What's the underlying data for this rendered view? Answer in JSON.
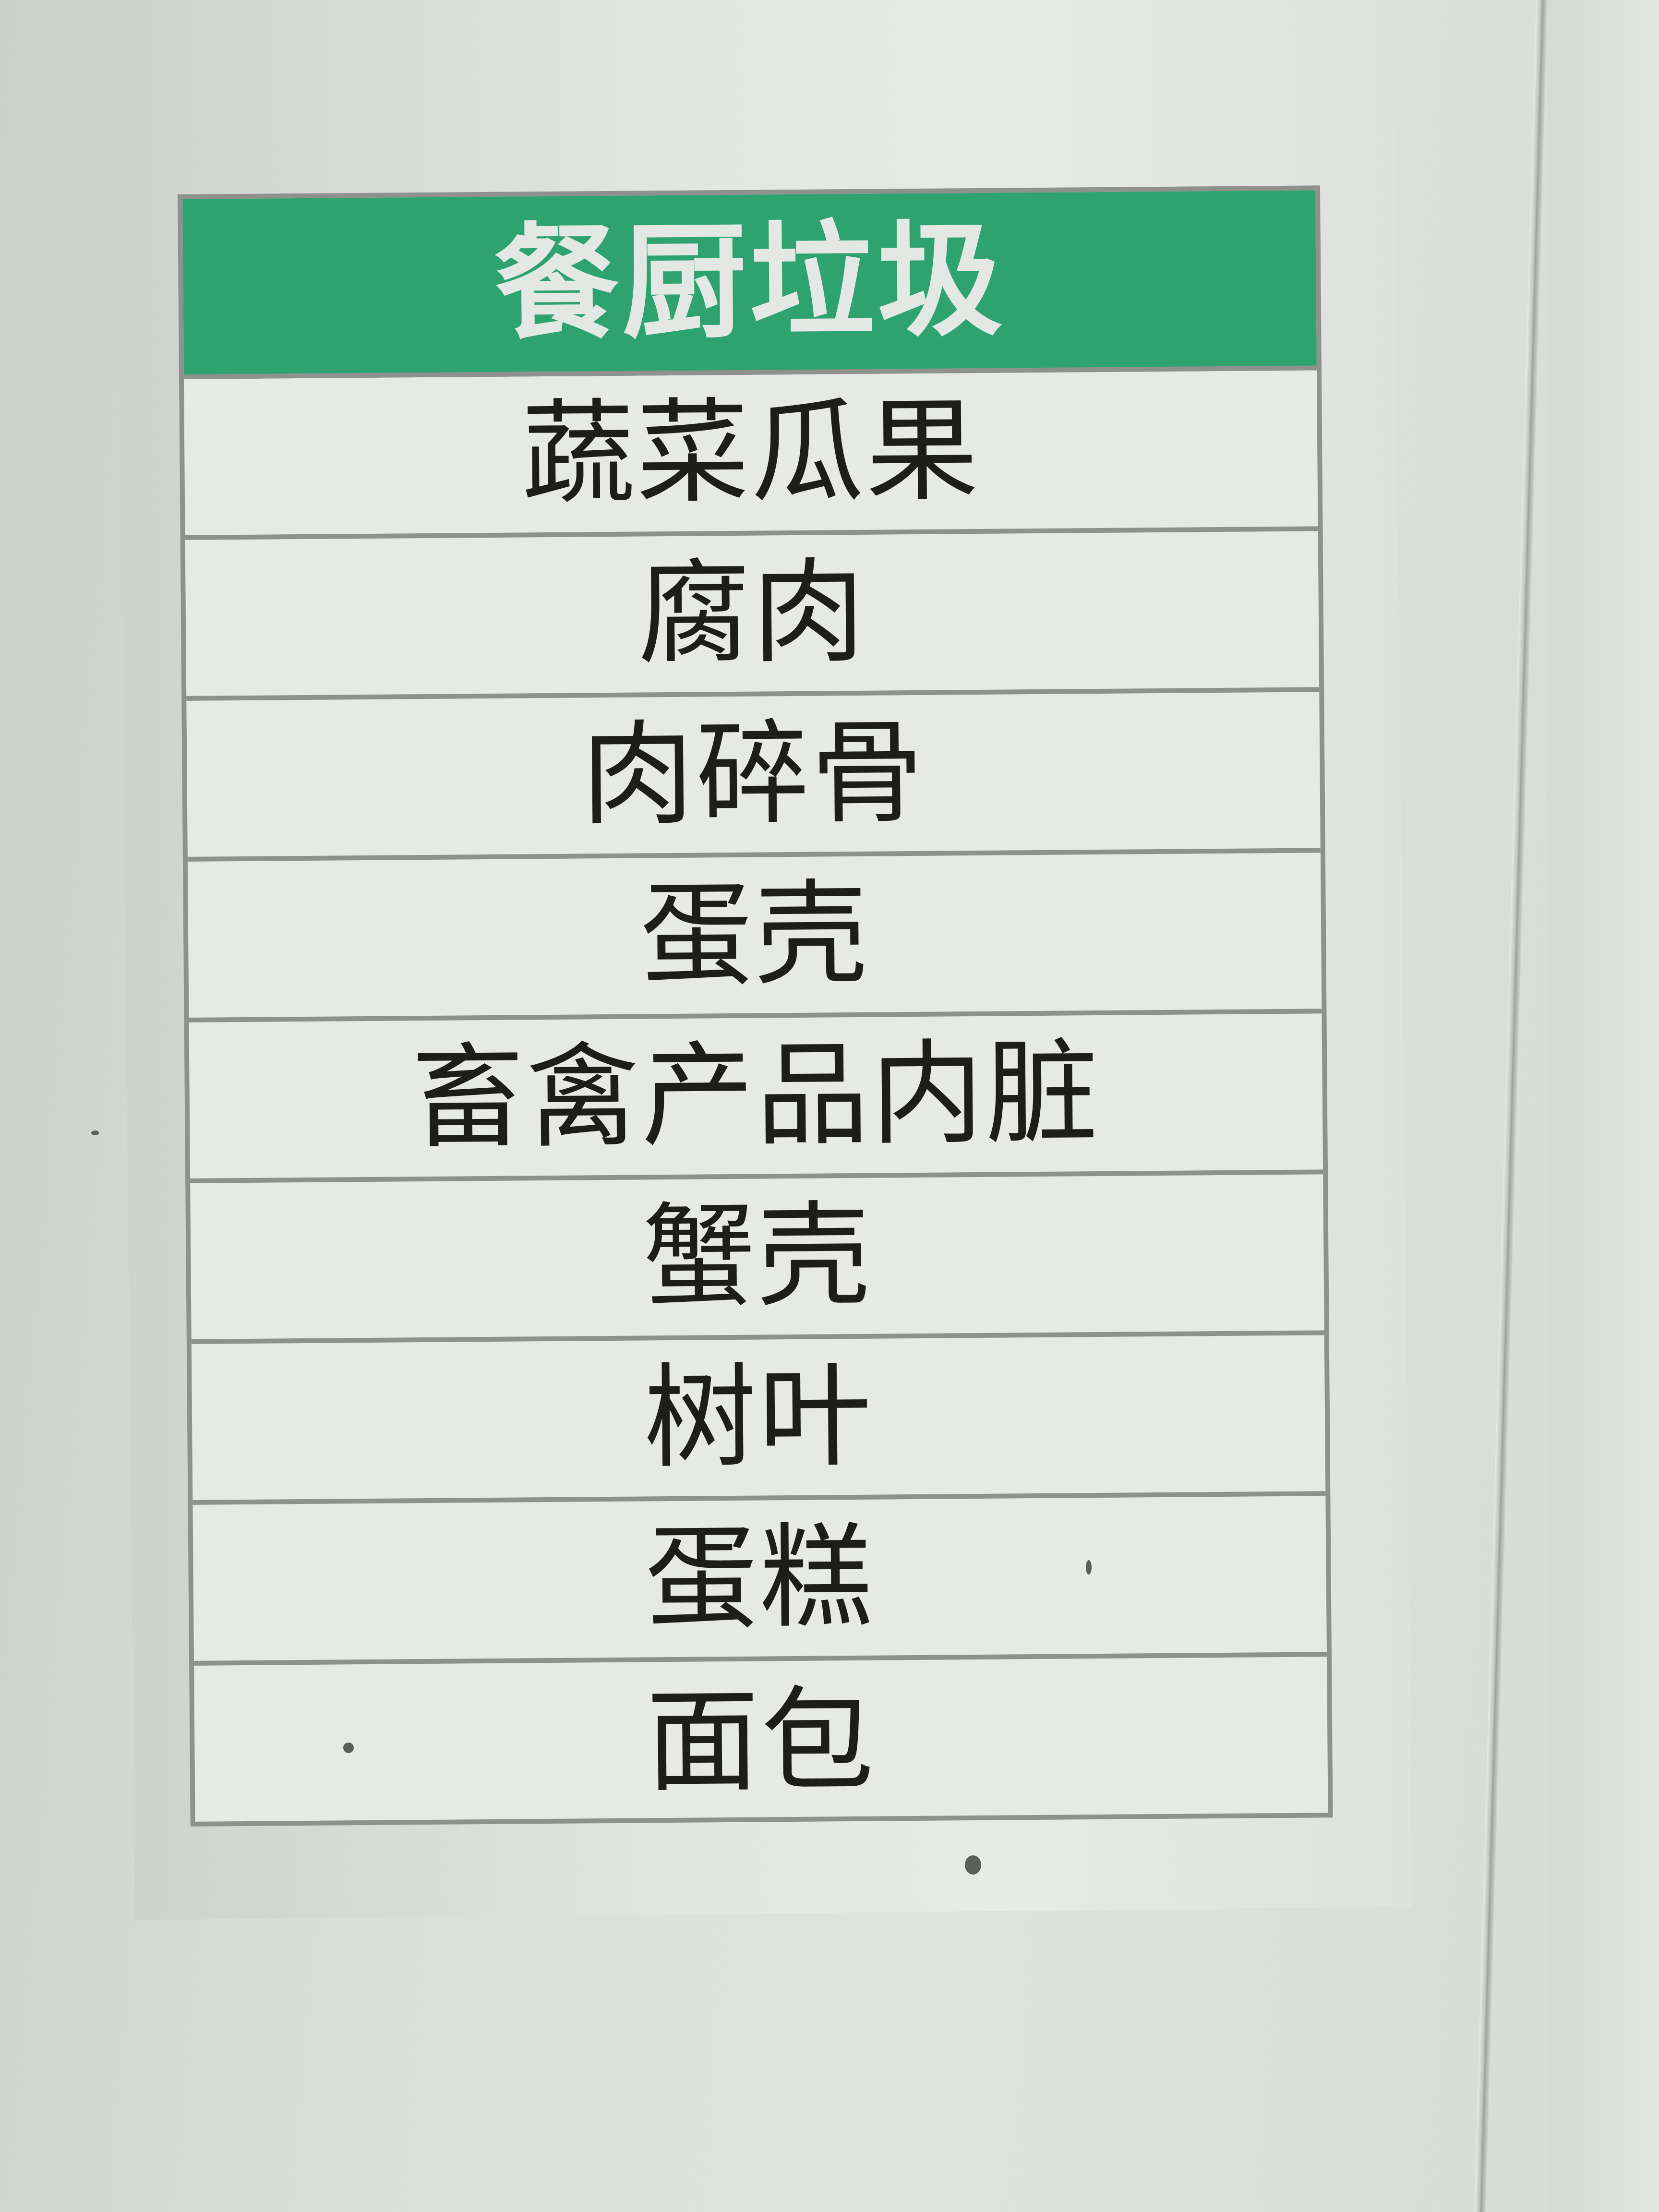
{
  "sign": {
    "title": "餐厨垃圾",
    "items": [
      "蔬菜瓜果",
      "腐肉",
      "肉碎骨",
      "蛋壳",
      "畜禽产品内脏",
      "蟹壳",
      "树叶",
      "蛋糕",
      "面包"
    ]
  },
  "colors": {
    "header_green": "#2fa36f",
    "header_text": "#e3e8e5",
    "item_text": "#1d1d1b",
    "rule_gray": "#8f918f"
  }
}
